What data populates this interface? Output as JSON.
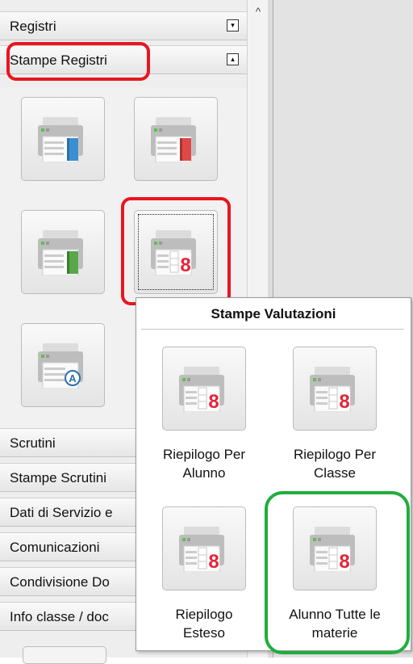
{
  "sidebar": {
    "sections": {
      "registri": "Registri",
      "stampe_registri": "Stampe Registri",
      "scrutini": "Scrutini",
      "stampe_scrutini": "Stampe Scrutini",
      "dati_servizio": "Dati di Servizio e",
      "comunicazioni": "Comunicazioni",
      "condivisione": "Condivisione Do",
      "info_classe": "Info classe / doc"
    },
    "toggles": {
      "collapsed": "▾",
      "expanded": "▴"
    },
    "scroll_up": "^"
  },
  "popup": {
    "title": "Stampe Valutazioni",
    "items": [
      {
        "label_1": "Riepilogo Per",
        "label_2": "Alunno"
      },
      {
        "label_1": "Riepilogo Per",
        "label_2": "Classe"
      },
      {
        "label_1": "Riepilogo",
        "label_2": "Esteso"
      },
      {
        "label_1": "Alunno Tutte le",
        "label_2": "materie"
      }
    ]
  },
  "icons": {
    "printer_blue": "printer-blue-book-icon",
    "printer_red": "printer-red-book-icon",
    "printer_green": "printer-green-book-icon",
    "printer_grades": "printer-grades-8-icon",
    "printer_a": "printer-letter-a-icon"
  },
  "colors": {
    "highlight_red": "#e8161f",
    "highlight_green": "#1fae3c",
    "book_blue": "#3a8fd0",
    "book_red": "#e04848",
    "book_green": "#58a84a",
    "grade_red": "#e5253a"
  }
}
